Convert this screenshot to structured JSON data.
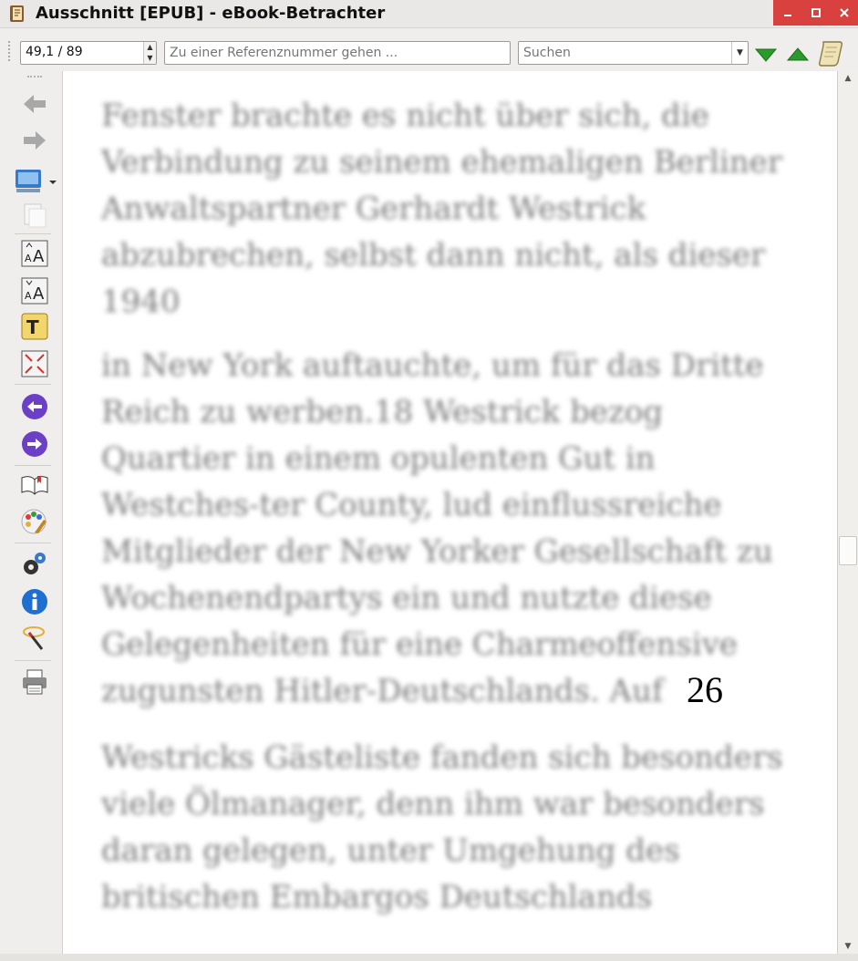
{
  "window": {
    "title": "Ausschnitt [EPUB] - eBook-Betrachter",
    "accent_color": "#d9413f"
  },
  "toolbar": {
    "position_value": "49,1 / 89",
    "reference_placeholder": "Zu einer Referenznummer gehen ...",
    "search_placeholder": "Suchen",
    "icons": [
      "arrow-down-green-icon",
      "arrow-up-green-icon",
      "scroll-icon"
    ]
  },
  "sidebar": {
    "icons": [
      "back-icon",
      "forward-icon",
      "monitor-icon",
      "copy-icon",
      "font-larger-icon",
      "font-smaller-icon",
      "text-style-icon",
      "fullscreen-icon",
      "previous-icon",
      "next-icon",
      "bookmark-book-icon",
      "theme-icon",
      "settings-icon",
      "info-icon",
      "magic-wand-icon",
      "print-icon"
    ]
  },
  "content": {
    "paragraphs": [
      "Fenster brachte es nicht über sich, die Verbindung zu seinem ehemaligen Berliner Anwaltspartner Gerhardt Westrick abzubrechen, selbst dann nicht, als dieser 1940",
      "in New York auftauchte, um für das Dritte Reich zu werben.18 Westrick bezog Quartier in einem opulenten Gut in Westches-ter County, lud einflussreiche Mitglieder der New Yorker Gesellschaft zu Wochenendpartys ein und nutzte diese Gelegenheiten für eine Charmeoffensive zugunsten Hitler-Deutschlands. Auf",
      "Westricks Gästeliste fanden sich besonders viele Ölmanager, denn ihm war besonders daran gelegen, unter Umgehung des britischen Embargos Deutschlands"
    ],
    "page_number": "26"
  },
  "scrollbar": {
    "position_fraction": 0.55
  }
}
